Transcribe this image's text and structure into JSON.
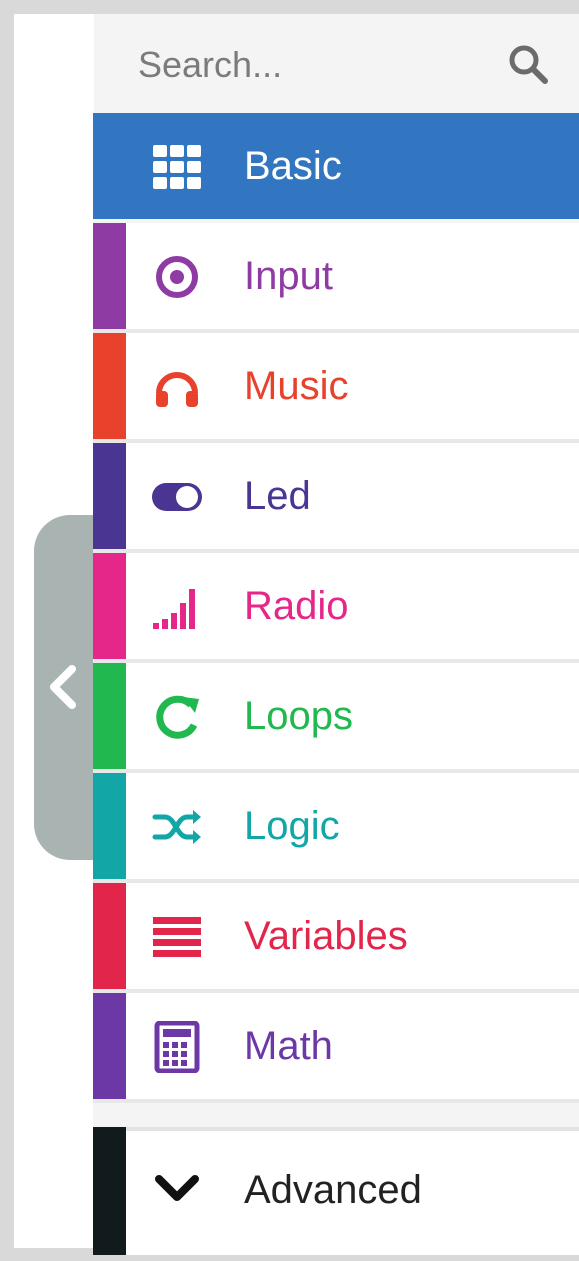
{
  "search": {
    "placeholder": "Search..."
  },
  "categories": [
    {
      "label": "Basic",
      "color": "#3275c0",
      "icon": "grid-icon"
    },
    {
      "label": "Input",
      "color": "#8e3ba3",
      "icon": "radio-target-icon"
    },
    {
      "label": "Music",
      "color": "#e8412c",
      "icon": "headphones-icon"
    },
    {
      "label": "Led",
      "color": "#4a3593",
      "icon": "toggle-icon"
    },
    {
      "label": "Radio",
      "color": "#e5278a",
      "icon": "signal-bars-icon"
    },
    {
      "label": "Loops",
      "color": "#20b84f",
      "icon": "refresh-icon"
    },
    {
      "label": "Logic",
      "color": "#12a6a7",
      "icon": "shuffle-icon"
    },
    {
      "label": "Variables",
      "color": "#e2264b",
      "icon": "list-lines-icon"
    },
    {
      "label": "Math",
      "color": "#6c38a6",
      "icon": "calculator-icon"
    }
  ],
  "advanced": {
    "label": "Advanced",
    "color": "#111a1c",
    "icon": "chevron-down-icon"
  },
  "selected_category": "Basic"
}
